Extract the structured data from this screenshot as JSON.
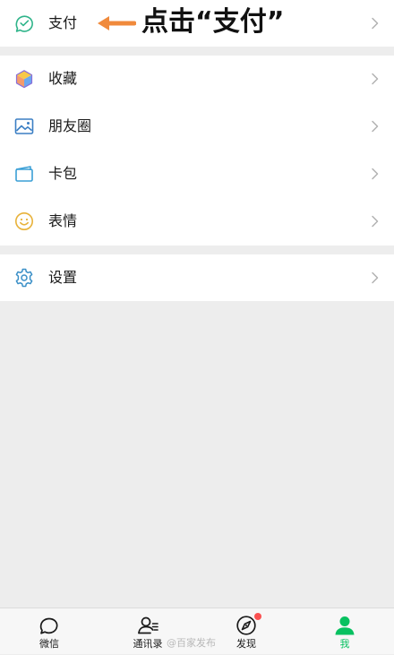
{
  "annotation": {
    "text": "点击“支付”"
  },
  "menu": {
    "pay": {
      "label": "支付",
      "icon": "pay-icon"
    },
    "favorites": {
      "label": "收藏",
      "icon": "favorites-icon"
    },
    "moments": {
      "label": "朋友圈",
      "icon": "moments-icon"
    },
    "cards": {
      "label": "卡包",
      "icon": "card-wallet-icon"
    },
    "stickers": {
      "label": "表情",
      "icon": "sticker-icon"
    },
    "settings": {
      "label": "设置",
      "icon": "settings-icon"
    }
  },
  "tabbar": {
    "chats": {
      "label": "微信",
      "icon": "chat-icon"
    },
    "contacts": {
      "label": "通讯录",
      "icon": "contacts-icon"
    },
    "discover": {
      "label": "发现",
      "icon": "discover-icon",
      "has_badge": true
    },
    "me": {
      "label": "我",
      "icon": "me-icon",
      "active": true
    }
  },
  "watermark": {
    "text": "@百家发布"
  },
  "colors": {
    "accent": "#07c160",
    "badge": "#fa5151",
    "annotation_arrow": "#f08a3c",
    "background": "#ededed"
  }
}
